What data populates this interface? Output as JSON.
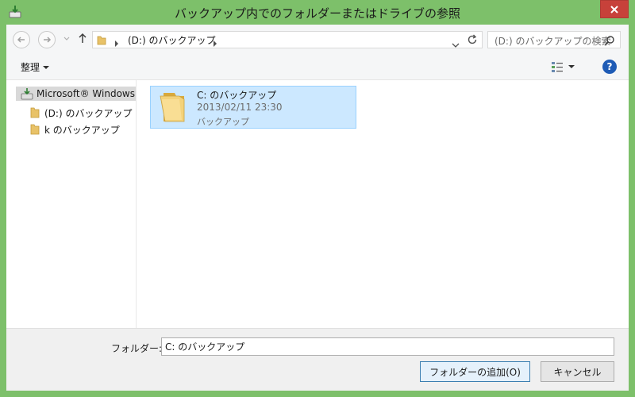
{
  "window": {
    "title": "バックアップ内でのフォルダーまたはドライブの参照"
  },
  "navigation": {
    "address": "(D:) のバックアップ",
    "search_placeholder": "(D:) のバックアップの検索"
  },
  "toolbar": {
    "organize_label": "整理",
    "help_label": "?"
  },
  "tree": {
    "items": [
      {
        "label": "Microsoft® Windows"
      },
      {
        "label": "(D:) のバックアップ"
      },
      {
        "label": "k のバックアップ"
      }
    ]
  },
  "content": {
    "items": [
      {
        "name": "C: のバックアップ",
        "date": "2013/02/11 23:30",
        "type": "バックアップ"
      }
    ]
  },
  "footer": {
    "folder_label": "フォルダー:",
    "folder_value": "C: のバックアップ",
    "add_button": "フォルダーの追加(O)",
    "cancel_button": "キャンセル"
  },
  "colors": {
    "frame": "#7dc06a",
    "close_button": "#c7413a",
    "selection": "#cce8ff",
    "selection_border": "#99d1ff"
  },
  "icons": {
    "app": "backup-app-icon",
    "close": "close-icon",
    "back": "back-arrow-icon",
    "forward": "forward-arrow-icon",
    "up": "up-arrow-icon",
    "refresh": "refresh-icon",
    "search": "search-icon",
    "folder": "folder-icon",
    "view": "view-options-icon",
    "help": "help-icon"
  }
}
